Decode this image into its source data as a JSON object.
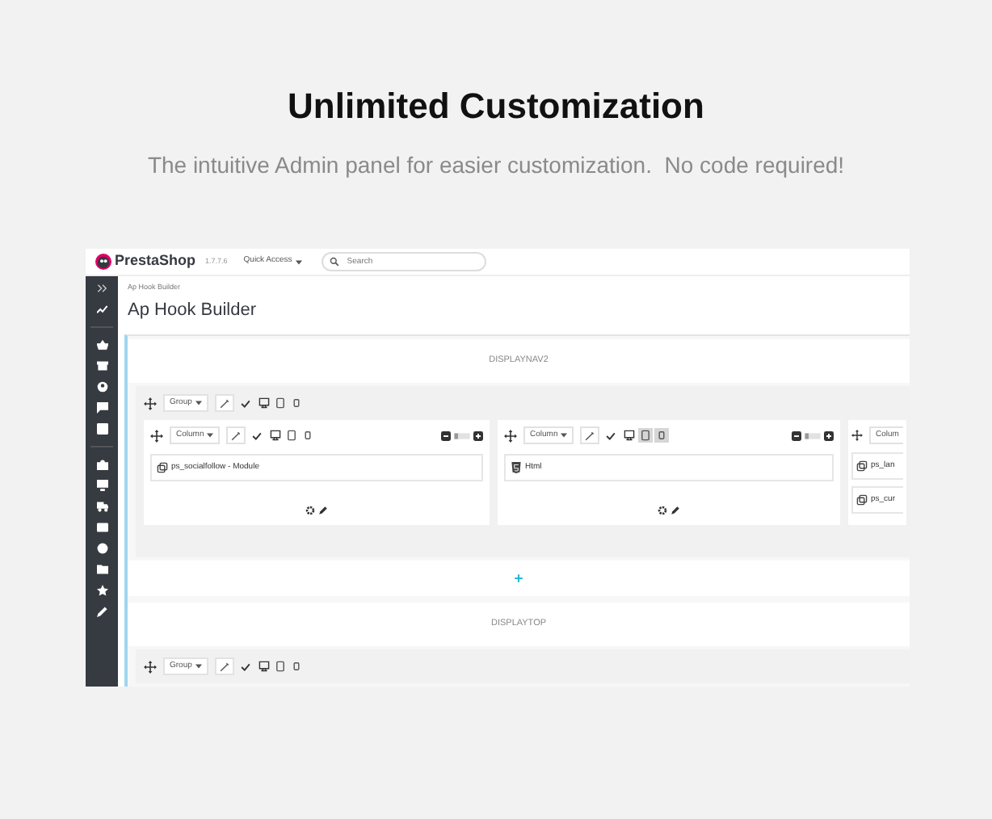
{
  "headline": "Unlimited Customization",
  "subtitle": "The intuitive Admin panel for easier customization.  No code required!",
  "app": {
    "logo": "PrestaShop",
    "version": "1.7.7.6",
    "quick_access": "Quick Access",
    "search": {
      "placeholder": "Search"
    },
    "breadcrumb": "Ap Hook Builder",
    "title": "Ap Hook Builder"
  },
  "hooks": [
    {
      "kind": "hook",
      "name": "DISPLAYNAV2",
      "groups": [
        {
          "label": "Group",
          "columns": [
            {
              "label": "Column",
              "device_highlight": [
                false,
                false,
                false
              ],
              "widgets": [
                {
                  "kind": "module",
                  "label": "ps_socialfollow - Module"
                }
              ]
            },
            {
              "label": "Column",
              "device_highlight": [
                false,
                true,
                true
              ],
              "widgets": [
                {
                  "kind": "html",
                  "label": "Html"
                }
              ]
            },
            {
              "label": "Colum",
              "cut": true,
              "widgets": [
                {
                  "kind": "module",
                  "label": "ps_lan"
                },
                {
                  "kind": "module",
                  "label": "ps_cur"
                }
              ]
            }
          ]
        }
      ]
    },
    {
      "kind": "add_row"
    },
    {
      "kind": "hook",
      "name": "DISPLAYTOP",
      "groups": [
        {
          "label": "Group"
        }
      ]
    }
  ]
}
